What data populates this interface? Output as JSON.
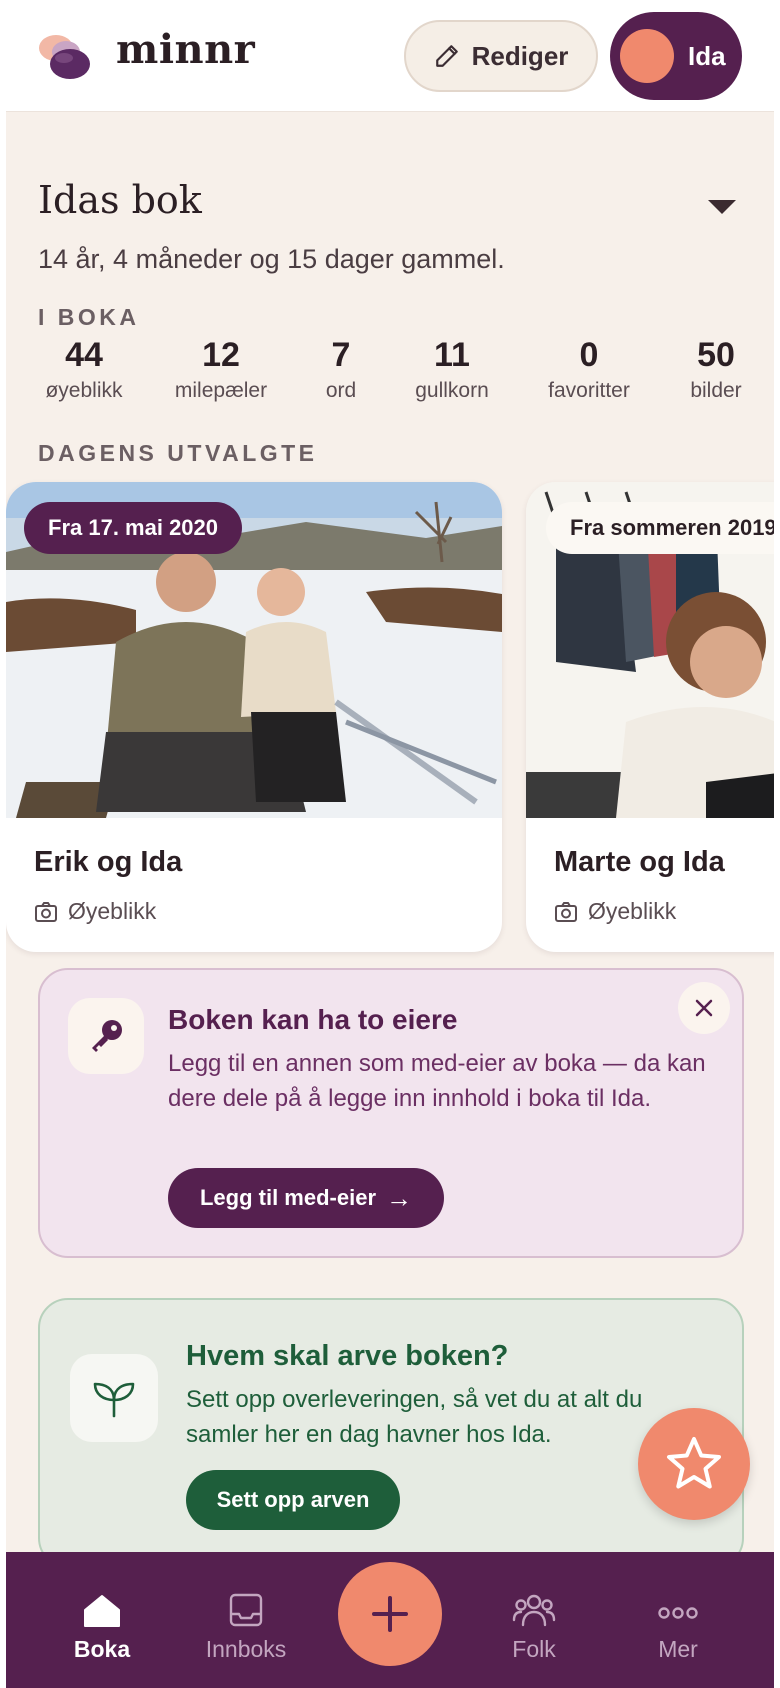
{
  "header": {
    "brand": "minnr",
    "edit_label": "Rediger",
    "user_label": "Ida"
  },
  "book": {
    "title": "Idas bok",
    "age": "14 år, 4 måneder og 15 dager gammel."
  },
  "in_book": {
    "label": "I BOKA",
    "stats": [
      {
        "value": "44",
        "label": "øyeblikk"
      },
      {
        "value": "12",
        "label": "milepæler"
      },
      {
        "value": "7",
        "label": "ord"
      },
      {
        "value": "11",
        "label": "gullkorn"
      },
      {
        "value": "0",
        "label": "favoritter"
      },
      {
        "value": "50",
        "label": "bilder"
      }
    ]
  },
  "featured": {
    "label": "DAGENS UTVALGTE",
    "cards": [
      {
        "date": "Fra 17. mai 2020",
        "title": "Erik og Ida",
        "type": "Øyeblikk"
      },
      {
        "date": "Fra sommeren 2019",
        "title": "Marte og Ida",
        "type": "Øyeblikk"
      }
    ]
  },
  "owners_card": {
    "title": "Boken kan ha to eiere",
    "text": "Legg til en annen som med-eier av boka — da kan dere dele på å legge inn innhold i boka til Ida.",
    "button": "Legg til med-eier",
    "arrow": "→"
  },
  "inherit_card": {
    "title": "Hvem skal arve boken?",
    "text": "Sett opp overleveringen, så vet du at alt du samler her en dag havner hos Ida.",
    "button": "Sett opp arven"
  },
  "nav": {
    "items": [
      {
        "label": "Boka",
        "icon": "home-icon"
      },
      {
        "label": "Innboks",
        "icon": "inbox-icon"
      },
      {
        "label": "Folk",
        "icon": "people-icon"
      },
      {
        "label": "Mer",
        "icon": "more-icon"
      }
    ]
  },
  "colors": {
    "brand_purple": "#55204f",
    "accent_coral": "#f0896d",
    "green": "#1e5e3a",
    "background": "#f7f0ea"
  }
}
